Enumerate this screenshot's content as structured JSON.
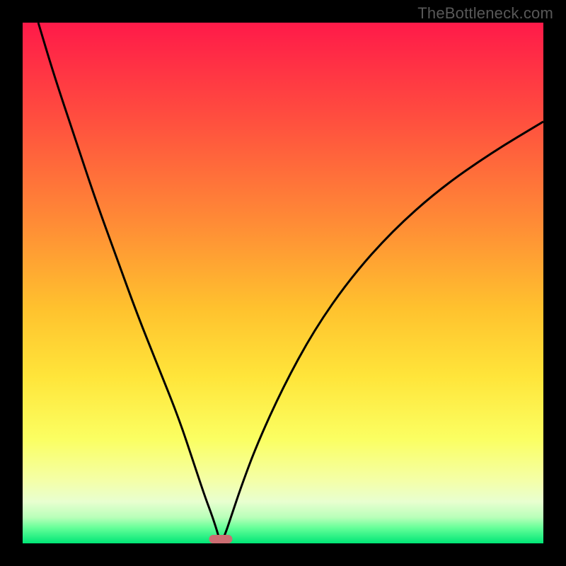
{
  "watermark": "TheBottleneck.com",
  "colors": {
    "frame": "#000000",
    "curve": "#000000",
    "marker": "#cc6d72"
  },
  "chart_data": {
    "type": "line",
    "title": "",
    "xlabel": "",
    "ylabel": "",
    "xlim": [
      0,
      100
    ],
    "ylim": [
      0,
      100
    ],
    "optimum_x": 38,
    "marker": {
      "x": 38,
      "y": 0,
      "width_pct": 4.5
    },
    "gradient_stops": [
      {
        "pos": 0,
        "color": "#ff1a49"
      },
      {
        "pos": 18,
        "color": "#ff4d3f"
      },
      {
        "pos": 38,
        "color": "#ff8a36"
      },
      {
        "pos": 55,
        "color": "#ffc22e"
      },
      {
        "pos": 68,
        "color": "#ffe53a"
      },
      {
        "pos": 80,
        "color": "#fbff62"
      },
      {
        "pos": 88,
        "color": "#f4ffa8"
      },
      {
        "pos": 92,
        "color": "#e8ffd0"
      },
      {
        "pos": 95,
        "color": "#b9ffb9"
      },
      {
        "pos": 97,
        "color": "#66ff99"
      },
      {
        "pos": 100,
        "color": "#00e676"
      }
    ],
    "series": [
      {
        "name": "left_branch",
        "x": [
          3,
          6,
          10,
          14,
          18,
          22,
          26,
          30,
          33,
          35,
          36.5,
          37.6,
          38
        ],
        "y": [
          100,
          90,
          78,
          66,
          55,
          44,
          34,
          24,
          15,
          9,
          5,
          1.5,
          0
        ]
      },
      {
        "name": "right_branch",
        "x": [
          38,
          38.8,
          40,
          42,
          45,
          50,
          56,
          63,
          71,
          80,
          90,
          100
        ],
        "y": [
          0,
          1.5,
          5,
          11,
          19,
          30,
          41,
          51,
          60,
          68,
          75,
          81
        ]
      }
    ]
  }
}
